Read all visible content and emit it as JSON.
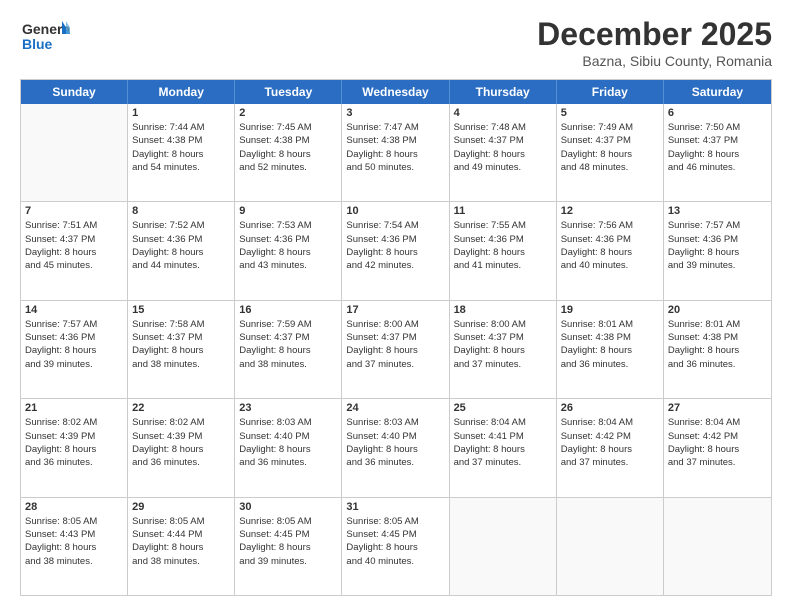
{
  "header": {
    "logo_line1": "General",
    "logo_line2": "Blue",
    "month": "December 2025",
    "location": "Bazna, Sibiu County, Romania"
  },
  "weekdays": [
    "Sunday",
    "Monday",
    "Tuesday",
    "Wednesday",
    "Thursday",
    "Friday",
    "Saturday"
  ],
  "weeks": [
    [
      {
        "day": "",
        "text": ""
      },
      {
        "day": "1",
        "text": "Sunrise: 7:44 AM\nSunset: 4:38 PM\nDaylight: 8 hours\nand 54 minutes."
      },
      {
        "day": "2",
        "text": "Sunrise: 7:45 AM\nSunset: 4:38 PM\nDaylight: 8 hours\nand 52 minutes."
      },
      {
        "day": "3",
        "text": "Sunrise: 7:47 AM\nSunset: 4:38 PM\nDaylight: 8 hours\nand 50 minutes."
      },
      {
        "day": "4",
        "text": "Sunrise: 7:48 AM\nSunset: 4:37 PM\nDaylight: 8 hours\nand 49 minutes."
      },
      {
        "day": "5",
        "text": "Sunrise: 7:49 AM\nSunset: 4:37 PM\nDaylight: 8 hours\nand 48 minutes."
      },
      {
        "day": "6",
        "text": "Sunrise: 7:50 AM\nSunset: 4:37 PM\nDaylight: 8 hours\nand 46 minutes."
      }
    ],
    [
      {
        "day": "7",
        "text": "Sunrise: 7:51 AM\nSunset: 4:37 PM\nDaylight: 8 hours\nand 45 minutes."
      },
      {
        "day": "8",
        "text": "Sunrise: 7:52 AM\nSunset: 4:36 PM\nDaylight: 8 hours\nand 44 minutes."
      },
      {
        "day": "9",
        "text": "Sunrise: 7:53 AM\nSunset: 4:36 PM\nDaylight: 8 hours\nand 43 minutes."
      },
      {
        "day": "10",
        "text": "Sunrise: 7:54 AM\nSunset: 4:36 PM\nDaylight: 8 hours\nand 42 minutes."
      },
      {
        "day": "11",
        "text": "Sunrise: 7:55 AM\nSunset: 4:36 PM\nDaylight: 8 hours\nand 41 minutes."
      },
      {
        "day": "12",
        "text": "Sunrise: 7:56 AM\nSunset: 4:36 PM\nDaylight: 8 hours\nand 40 minutes."
      },
      {
        "day": "13",
        "text": "Sunrise: 7:57 AM\nSunset: 4:36 PM\nDaylight: 8 hours\nand 39 minutes."
      }
    ],
    [
      {
        "day": "14",
        "text": "Sunrise: 7:57 AM\nSunset: 4:36 PM\nDaylight: 8 hours\nand 39 minutes."
      },
      {
        "day": "15",
        "text": "Sunrise: 7:58 AM\nSunset: 4:37 PM\nDaylight: 8 hours\nand 38 minutes."
      },
      {
        "day": "16",
        "text": "Sunrise: 7:59 AM\nSunset: 4:37 PM\nDaylight: 8 hours\nand 38 minutes."
      },
      {
        "day": "17",
        "text": "Sunrise: 8:00 AM\nSunset: 4:37 PM\nDaylight: 8 hours\nand 37 minutes."
      },
      {
        "day": "18",
        "text": "Sunrise: 8:00 AM\nSunset: 4:37 PM\nDaylight: 8 hours\nand 37 minutes."
      },
      {
        "day": "19",
        "text": "Sunrise: 8:01 AM\nSunset: 4:38 PM\nDaylight: 8 hours\nand 36 minutes."
      },
      {
        "day": "20",
        "text": "Sunrise: 8:01 AM\nSunset: 4:38 PM\nDaylight: 8 hours\nand 36 minutes."
      }
    ],
    [
      {
        "day": "21",
        "text": "Sunrise: 8:02 AM\nSunset: 4:39 PM\nDaylight: 8 hours\nand 36 minutes."
      },
      {
        "day": "22",
        "text": "Sunrise: 8:02 AM\nSunset: 4:39 PM\nDaylight: 8 hours\nand 36 minutes."
      },
      {
        "day": "23",
        "text": "Sunrise: 8:03 AM\nSunset: 4:40 PM\nDaylight: 8 hours\nand 36 minutes."
      },
      {
        "day": "24",
        "text": "Sunrise: 8:03 AM\nSunset: 4:40 PM\nDaylight: 8 hours\nand 36 minutes."
      },
      {
        "day": "25",
        "text": "Sunrise: 8:04 AM\nSunset: 4:41 PM\nDaylight: 8 hours\nand 37 minutes."
      },
      {
        "day": "26",
        "text": "Sunrise: 8:04 AM\nSunset: 4:42 PM\nDaylight: 8 hours\nand 37 minutes."
      },
      {
        "day": "27",
        "text": "Sunrise: 8:04 AM\nSunset: 4:42 PM\nDaylight: 8 hours\nand 37 minutes."
      }
    ],
    [
      {
        "day": "28",
        "text": "Sunrise: 8:05 AM\nSunset: 4:43 PM\nDaylight: 8 hours\nand 38 minutes."
      },
      {
        "day": "29",
        "text": "Sunrise: 8:05 AM\nSunset: 4:44 PM\nDaylight: 8 hours\nand 38 minutes."
      },
      {
        "day": "30",
        "text": "Sunrise: 8:05 AM\nSunset: 4:45 PM\nDaylight: 8 hours\nand 39 minutes."
      },
      {
        "day": "31",
        "text": "Sunrise: 8:05 AM\nSunset: 4:45 PM\nDaylight: 8 hours\nand 40 minutes."
      },
      {
        "day": "",
        "text": ""
      },
      {
        "day": "",
        "text": ""
      },
      {
        "day": "",
        "text": ""
      }
    ]
  ]
}
